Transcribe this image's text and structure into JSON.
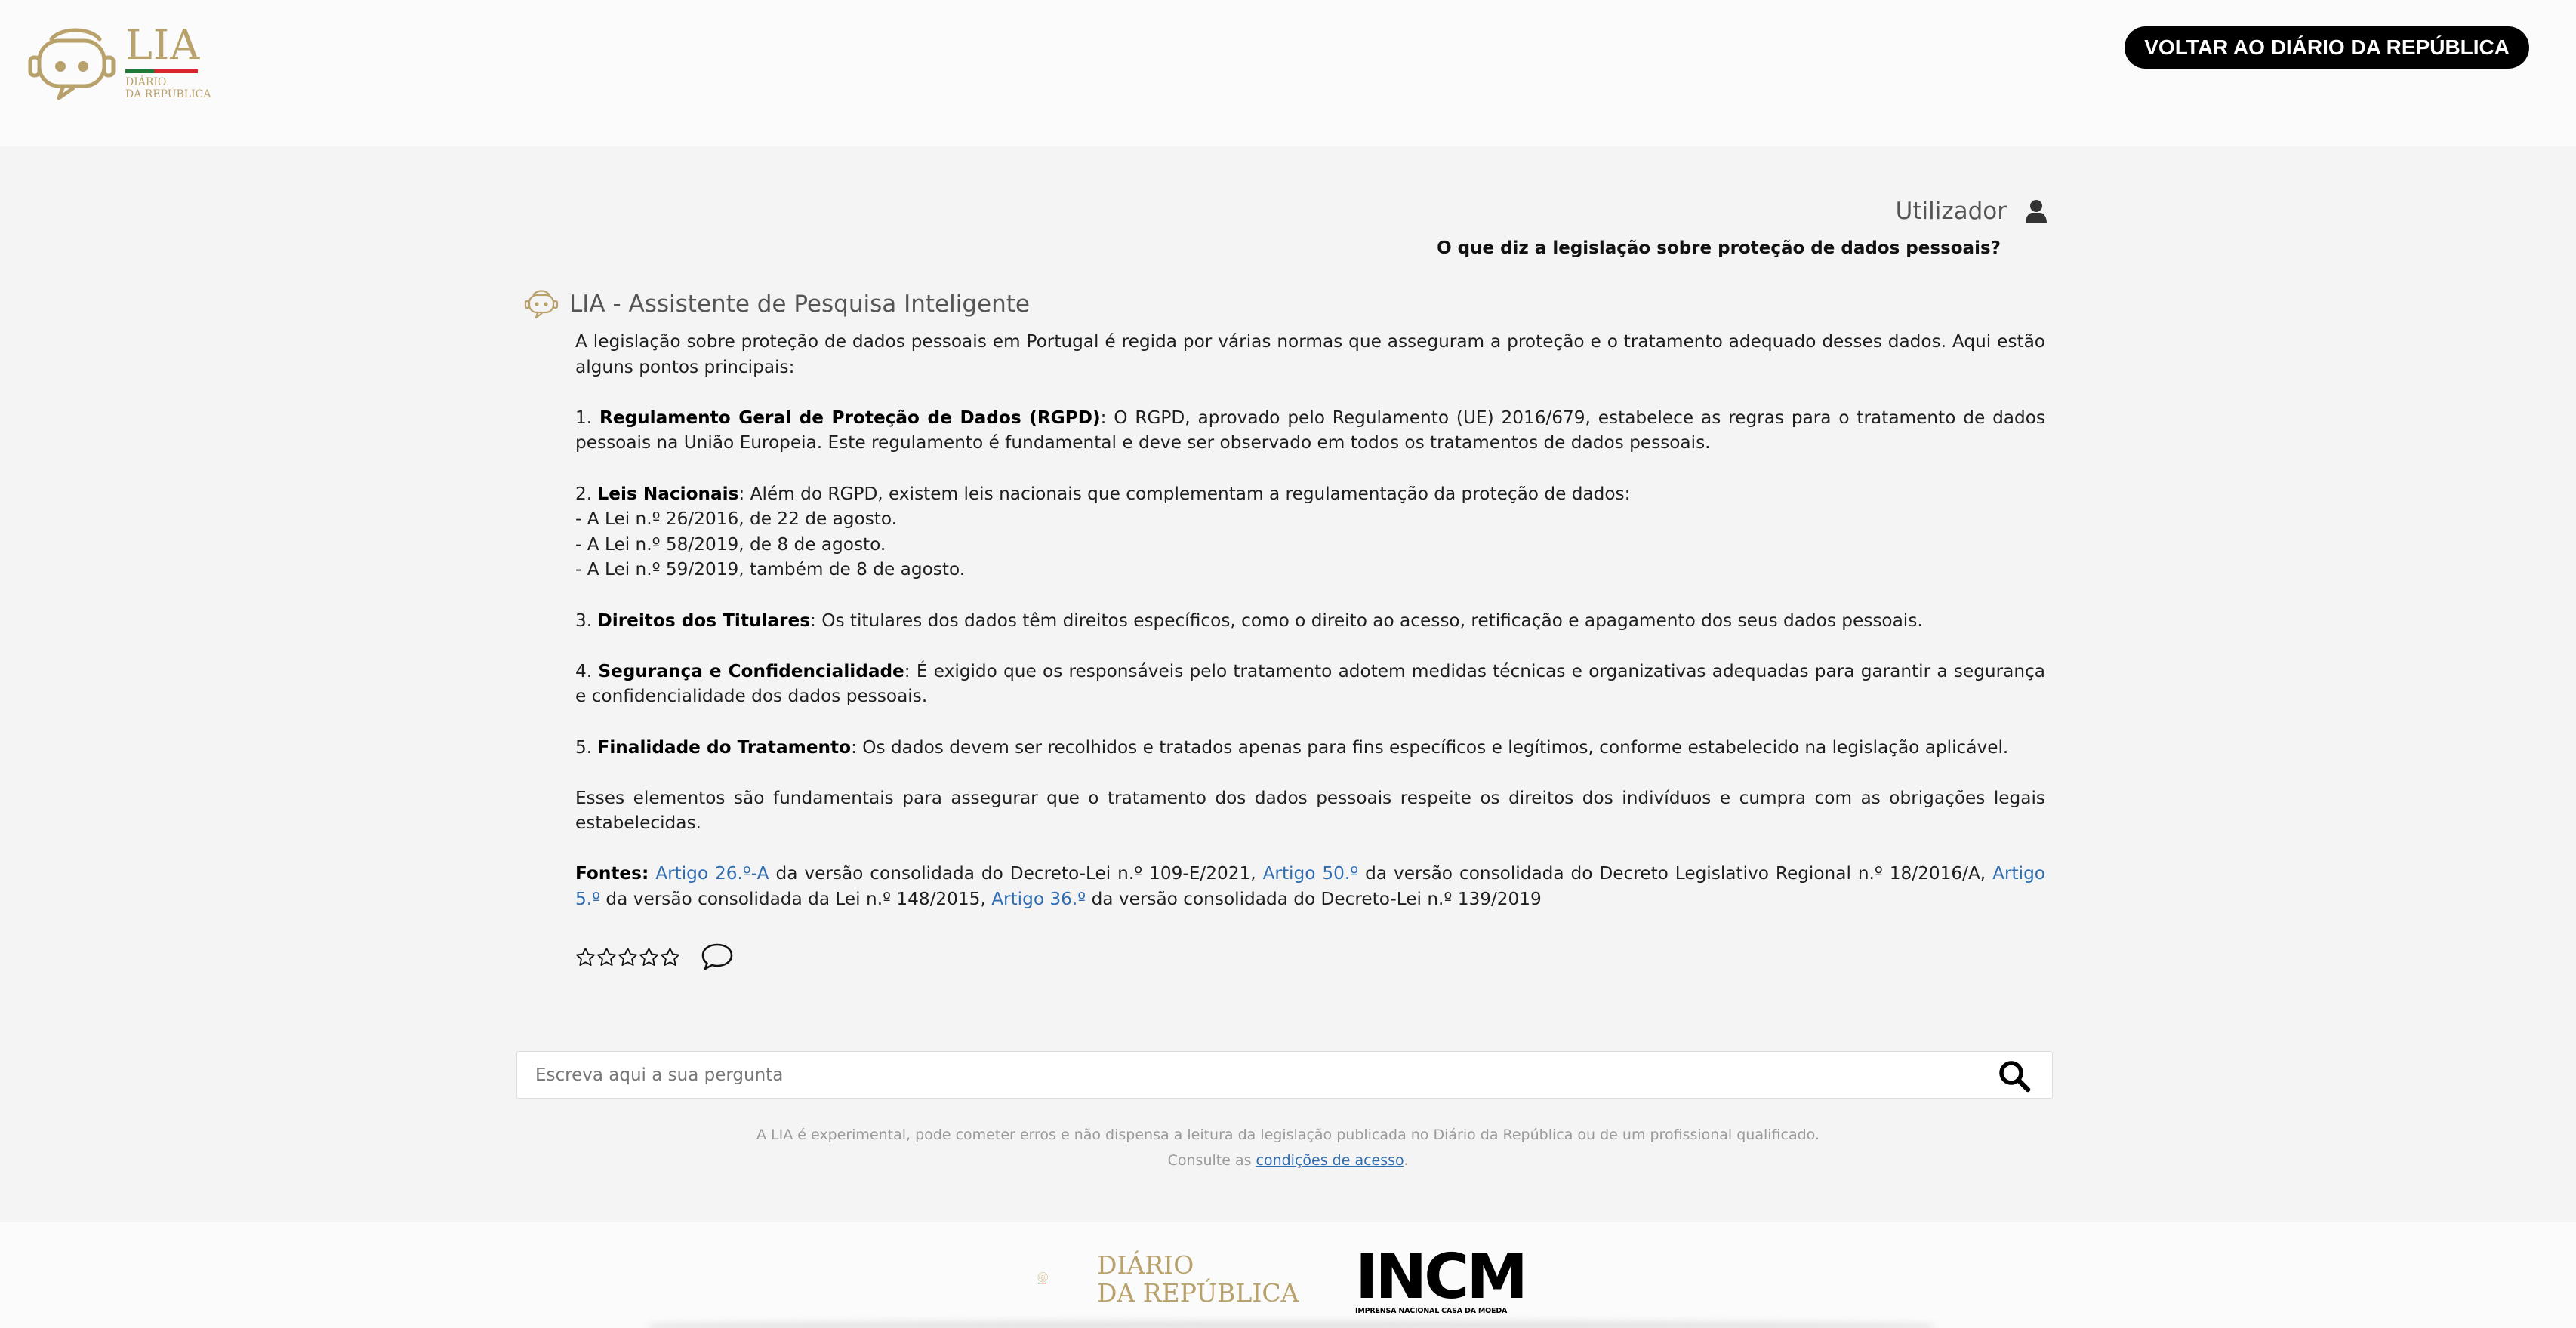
{
  "header": {
    "logo_title": "LIA",
    "logo_sub_1": "DIÁRIO",
    "logo_sub_2": "DA REPÚBLICA",
    "back_button": "VOLTAR AO DIÁRIO DA REPÚBLICA"
  },
  "user": {
    "label": "Utilizador",
    "question": "O que diz a legislação sobre proteção de dados pessoais?"
  },
  "assistant": {
    "name": "LIA - Assistente de Pesquisa Inteligente",
    "intro": "A legislação sobre proteção de dados pessoais em Portugal é regida por várias normas que asseguram a proteção e o tratamento adequado desses dados. Aqui estão alguns pontos principais:",
    "p1_num": "1.",
    "p1_title": "Regulamento Geral de Proteção de Dados (RGPD)",
    "p1_text": ": O RGPD, aprovado pelo Regulamento (UE) 2016/679, estabelece as regras para o tratamento de dados pessoais na União Europeia. Este regulamento é fundamental e deve ser observado em todos os tratamentos de dados pessoais.",
    "p2_num": "2.",
    "p2_title": "Leis Nacionais",
    "p2_text": ": Além do RGPD, existem leis nacionais que complementam a regulamentação da proteção de dados:",
    "p2_items": [
      "- A Lei n.º 26/2016, de 22 de agosto.",
      "- A Lei n.º 58/2019, de 8 de agosto.",
      "- A Lei n.º 59/2019, também de 8 de agosto."
    ],
    "p3_num": "3.",
    "p3_title": "Direitos dos Titulares",
    "p3_text": ": Os titulares dos dados têm direitos específicos, como o direito ao acesso, retificação e apagamento dos seus dados pessoais.",
    "p4_num": "4.",
    "p4_title": "Segurança e Confidencialidade",
    "p4_text": ": É exigido que os responsáveis pelo tratamento adotem medidas técnicas e organizativas adequadas para garantir a segurança e confidencialidade dos dados pessoais.",
    "p5_num": "5.",
    "p5_title": "Finalidade do Tratamento",
    "p5_text": ": Os dados devem ser recolhidos e tratados apenas para fins específicos e legítimos, conforme estabelecido na legislação aplicável.",
    "conclusion": "Esses elementos são fundamentais para assegurar que o tratamento dos dados pessoais respeite os direitos dos indivíduos e cumpra com as obrigações legais estabelecidas.",
    "sources_label": "Fontes:",
    "src1_link": "Artigo 26.º-A",
    "src1_text": " da versão consolidada do Decreto-Lei n.º 109-E/2021, ",
    "src2_link": "Artigo 50.º",
    "src2_text": " da versão consolidada do Decreto Legislativo Regional n.º 18/2016/A, ",
    "src3_link": "Artigo 5.º",
    "src3_text": " da versão consolidada da Lei n.º 148/2015, ",
    "src4_link": "Artigo 36.º",
    "src4_text": " da versão consolidada do Decreto-Lei n.º 139/2019"
  },
  "rating": {
    "value": 0,
    "max": 5,
    "icon": "star-outline-icon"
  },
  "search": {
    "placeholder": "Escreva aqui a sua pergunta",
    "value": ""
  },
  "disclaimer": {
    "line1": "A LIA é experimental, pode cometer erros e não dispensa a leitura da legislação publicada no Diário da República ou de um profissional qualificado.",
    "line2_prefix": "Consulte as",
    "line2_link": "condições de acesso",
    "line2_suffix": "."
  },
  "footer": {
    "dr_line1": "DIÁRIO",
    "dr_line2": "DA REPÚBLICA",
    "incm_title": "INCM",
    "incm_sub": "IMPRENSA NACIONAL CASA DA MOEDA"
  },
  "colors": {
    "brand_gold": "#b9a16b",
    "link_blue": "#2f6db2",
    "button_black": "#000000",
    "page_bg": "#f4f4f4"
  }
}
